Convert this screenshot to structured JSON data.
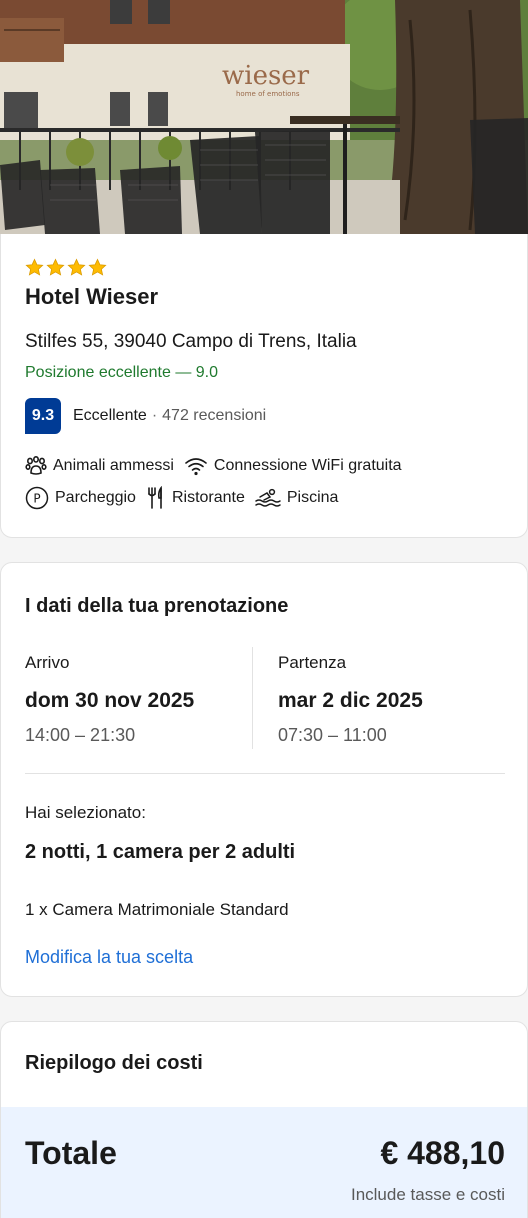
{
  "hotel": {
    "image_logo_text": "wieser",
    "image_logo_tagline": "home of emotions",
    "star_count": 4,
    "name": "Hotel Wieser",
    "address": "Stilfes 55, 39040 Campo di Trens, Italia",
    "location_rating": "Posizione eccellente — 9.0",
    "score": "9.3",
    "score_label": "Eccellente",
    "score_separator": "·",
    "review_count": "472 recensioni",
    "amenities": [
      {
        "icon": "paw-icon",
        "label": "Animali ammessi"
      },
      {
        "icon": "wifi-icon",
        "label": "Connessione WiFi gratuita"
      },
      {
        "icon": "parking-icon",
        "label": "Parcheggio"
      },
      {
        "icon": "cutlery-icon",
        "label": "Ristorante"
      },
      {
        "icon": "swimming-icon",
        "label": "Piscina"
      }
    ]
  },
  "booking": {
    "title": "I dati della tua prenotazione",
    "checkin_label": "Arrivo",
    "checkin_date": "dom 30 nov 2025",
    "checkin_time": "14:00 – 21:30",
    "checkout_label": "Partenza",
    "checkout_date": "mar 2 dic 2025",
    "checkout_time": "07:30 – 11:00",
    "selected_label": "Hai selezionato:",
    "selected_summary": "2 notti, 1 camera per 2 adulti",
    "room": "1 x Camera Matrimoniale Standard",
    "modify_link": "Modifica la tua scelta"
  },
  "costs": {
    "title": "Riepilogo dei costi",
    "total_label": "Totale",
    "total_price": "€ 488,10",
    "total_note": "Include tasse e costi"
  },
  "colors": {
    "score_badge": "#003b95",
    "location_green": "#1f7a2e",
    "link_blue": "#1f6fd6",
    "total_band": "#ebf3ff",
    "star_gold": "#febb02"
  }
}
